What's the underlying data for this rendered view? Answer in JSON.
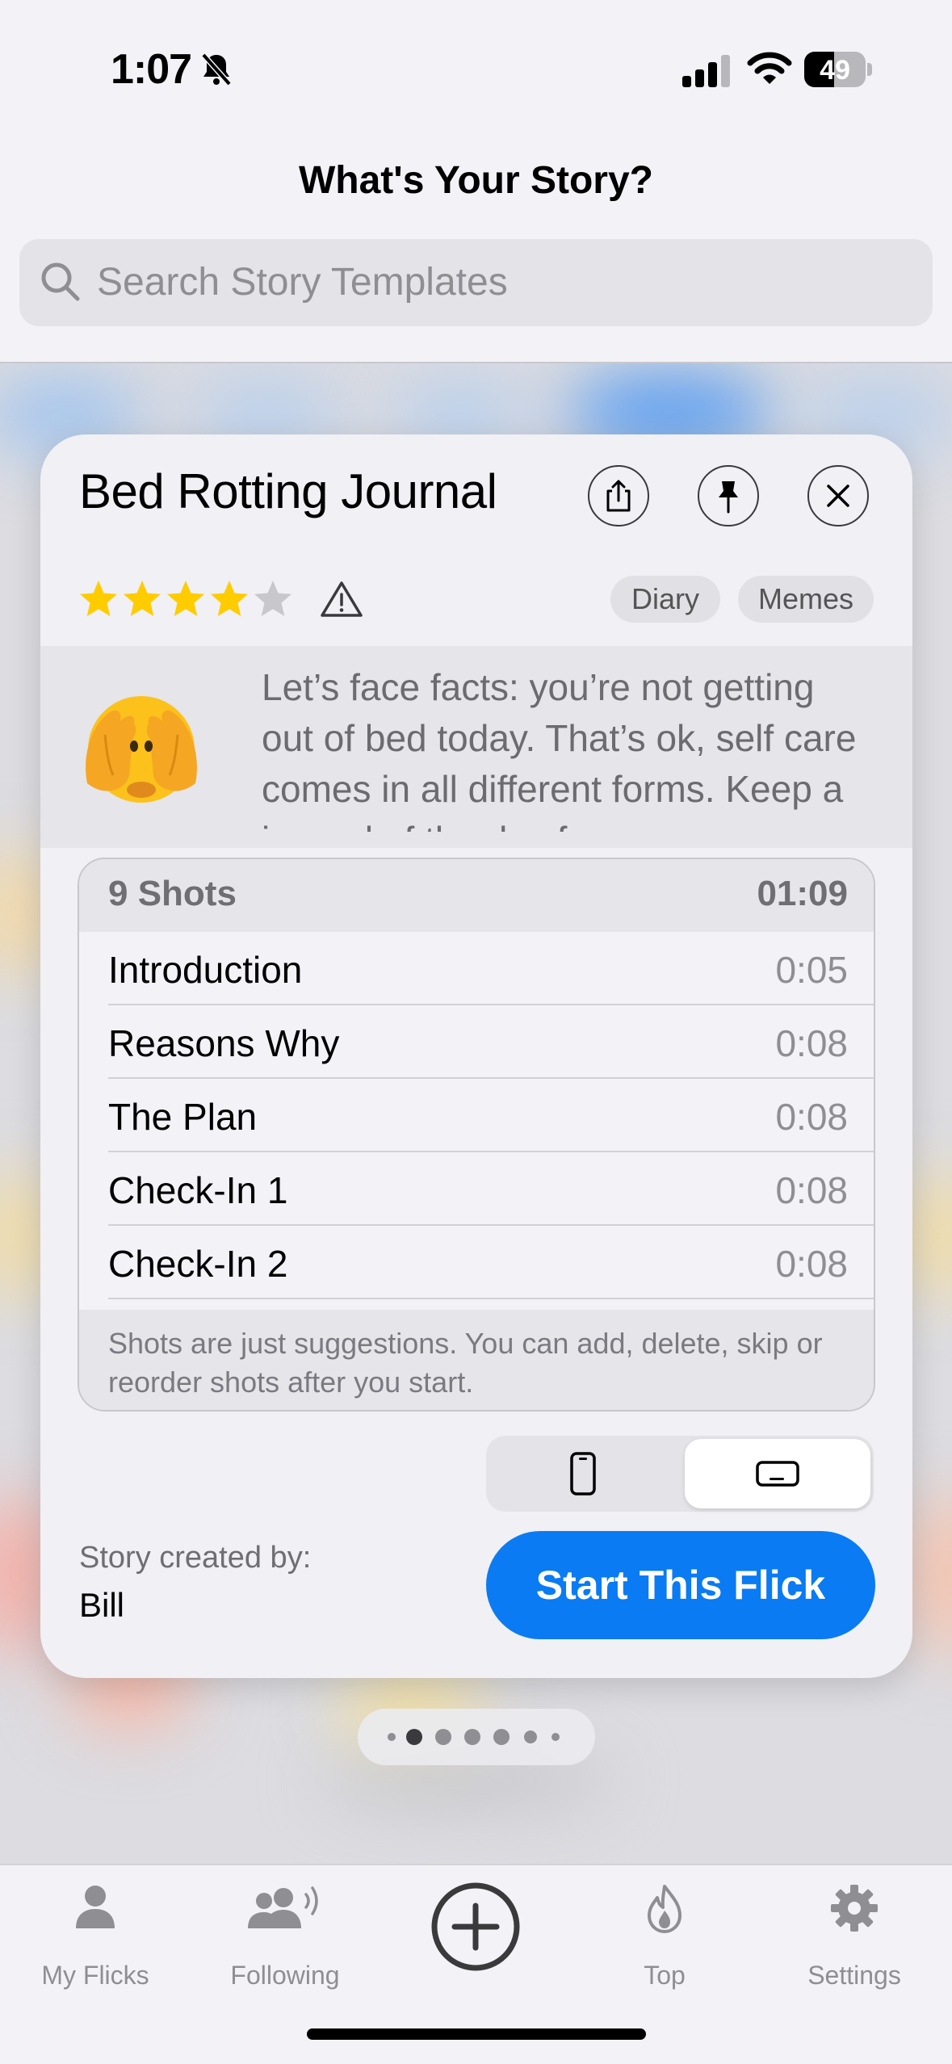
{
  "status_bar": {
    "time": "1:07",
    "battery": "49",
    "battery_level": 0.49
  },
  "header": {
    "title": "What's Your Story?"
  },
  "search": {
    "placeholder": "Search Story Templates"
  },
  "card": {
    "title": "Bed Rotting Journal",
    "rating": 4,
    "rating_max": 5,
    "tags": [
      "Diary",
      "Memes"
    ],
    "emoji": "face-with-hands-over-eyes",
    "description": "Let’s face facts: you’re not getting out of bed today. That’s ok, self care comes in all different forms. Keep a journal of the day for",
    "shots": {
      "count_label": "9 Shots",
      "total_duration": "01:09",
      "items": [
        {
          "name": "Introduction",
          "duration": "0:05"
        },
        {
          "name": "Reasons Why",
          "duration": "0:08"
        },
        {
          "name": "The Plan",
          "duration": "0:08"
        },
        {
          "name": "Check-In 1",
          "duration": "0:08"
        },
        {
          "name": "Check-In 2",
          "duration": "0:08"
        }
      ],
      "footer": "Shots are just suggestions. You can add, delete, skip or reorder shots after you start."
    },
    "orientation": {
      "selected": "landscape"
    },
    "created_by_label": "Story created by:",
    "created_by": "Bill",
    "start_button": "Start This Flick"
  },
  "pager": {
    "count": 7,
    "current": 1
  },
  "tabbar": {
    "items": [
      {
        "label": "My Flicks",
        "icon": "person-icon"
      },
      {
        "label": "Following",
        "icon": "people-icon"
      },
      {
        "label": "",
        "icon": "plus-circle-icon"
      },
      {
        "label": "Top",
        "icon": "flame-icon"
      },
      {
        "label": "Settings",
        "icon": "gear-icon"
      }
    ]
  },
  "colors": {
    "accent": "#0a7bf2",
    "star": "#ffcc00"
  }
}
